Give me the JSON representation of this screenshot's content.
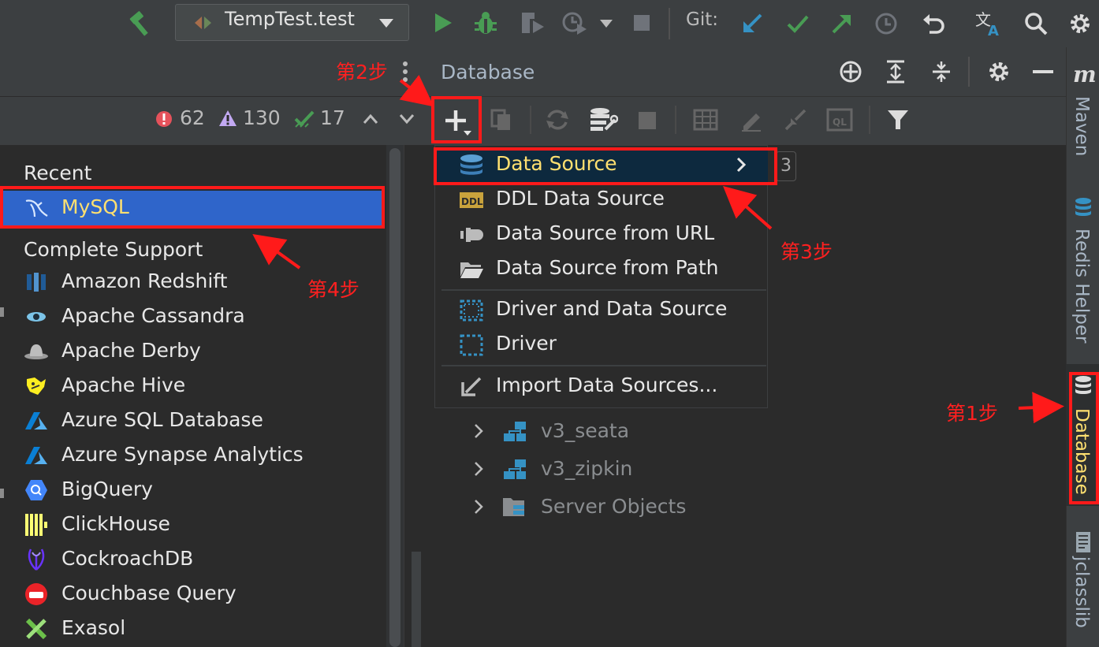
{
  "toolbar": {
    "run_config": "TempTest.test",
    "git_label": "Git:"
  },
  "problems": {
    "errors": "62",
    "warnings": "130",
    "ok": "17"
  },
  "datasource_list": {
    "recent_header": "Recent",
    "recent": [
      "MySQL"
    ],
    "complete_header": "Complete Support",
    "complete": [
      "Amazon Redshift",
      "Apache Cassandra",
      "Apache Derby",
      "Apache Hive",
      "Azure SQL Database",
      "Azure Synapse Analytics",
      "BigQuery",
      "ClickHouse",
      "CockroachDB",
      "Couchbase Query",
      "Exasol"
    ]
  },
  "database_panel": {
    "title": "Database",
    "hint_badge": "3",
    "add_menu": {
      "items": [
        "Data Source",
        "DDL Data Source",
        "Data Source from URL",
        "Data Source from Path",
        "Driver and Data Source",
        "Driver",
        "Import Data Sources..."
      ]
    },
    "tree": [
      "v3_seata",
      "v3_zipkin",
      "Server Objects"
    ]
  },
  "right_tabs": {
    "maven": "Maven",
    "redis": "Redis Helper",
    "database": "Database",
    "jclasslib": "jclasslib",
    "maven_glyph": "m"
  },
  "annotations": {
    "step1": "第1步",
    "step2": "第2步",
    "step3": "第3步",
    "step4": "第4步"
  },
  "colors": {
    "accent_green": "#499c54",
    "accent_blue": "#3592c4",
    "annotation_red": "#ff1a1a",
    "selection_blue": "#2f65ca"
  }
}
